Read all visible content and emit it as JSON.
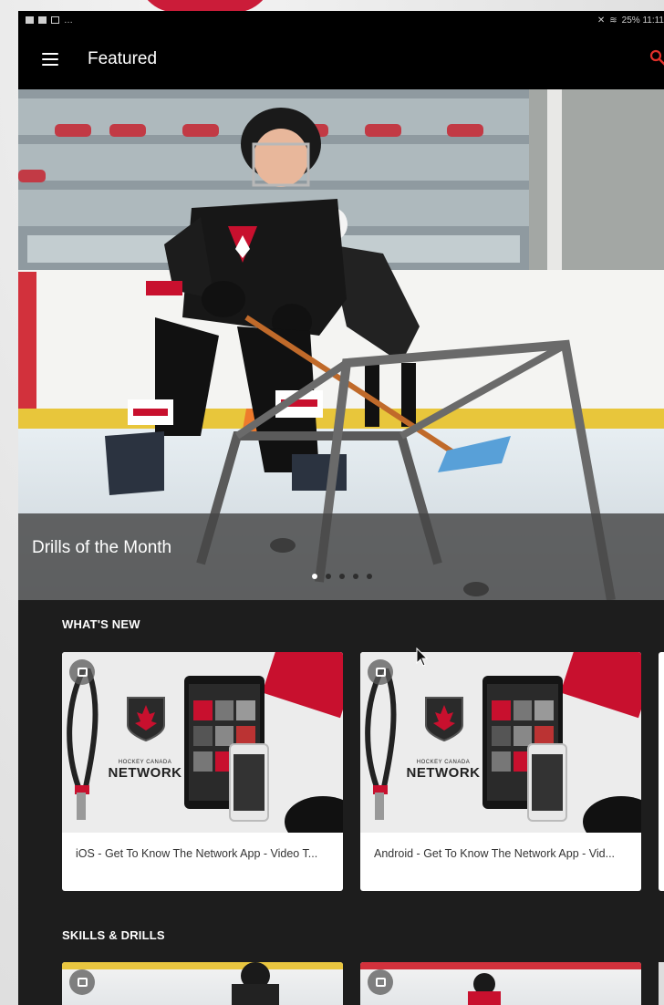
{
  "status_bar": {
    "right_text": "25% 11:11"
  },
  "app_bar": {
    "title": "Featured"
  },
  "hero": {
    "caption": "Drills of the Month",
    "dots_total": 5,
    "active_dot": 0
  },
  "sections": [
    {
      "label": "WHAT'S NEW",
      "cards": [
        {
          "title": "iOS - Get To Know The Network App - Video T...",
          "logo_small": "HOCKEY CANADA",
          "logo_big": "NETWORK"
        },
        {
          "title": "Android - Get To Know The Network App - Vid...",
          "logo_small": "HOCKEY CANADA",
          "logo_big": "NETWORK"
        }
      ]
    },
    {
      "label": "SKILLS & DRILLS"
    }
  ],
  "colors": {
    "brand_red": "#c8102e",
    "appbar": "#000000",
    "content_bg": "#1d1d1d"
  },
  "icons": [
    "menu-icon",
    "search-icon",
    "video-badge-icon",
    "maple-leaf-icon"
  ]
}
